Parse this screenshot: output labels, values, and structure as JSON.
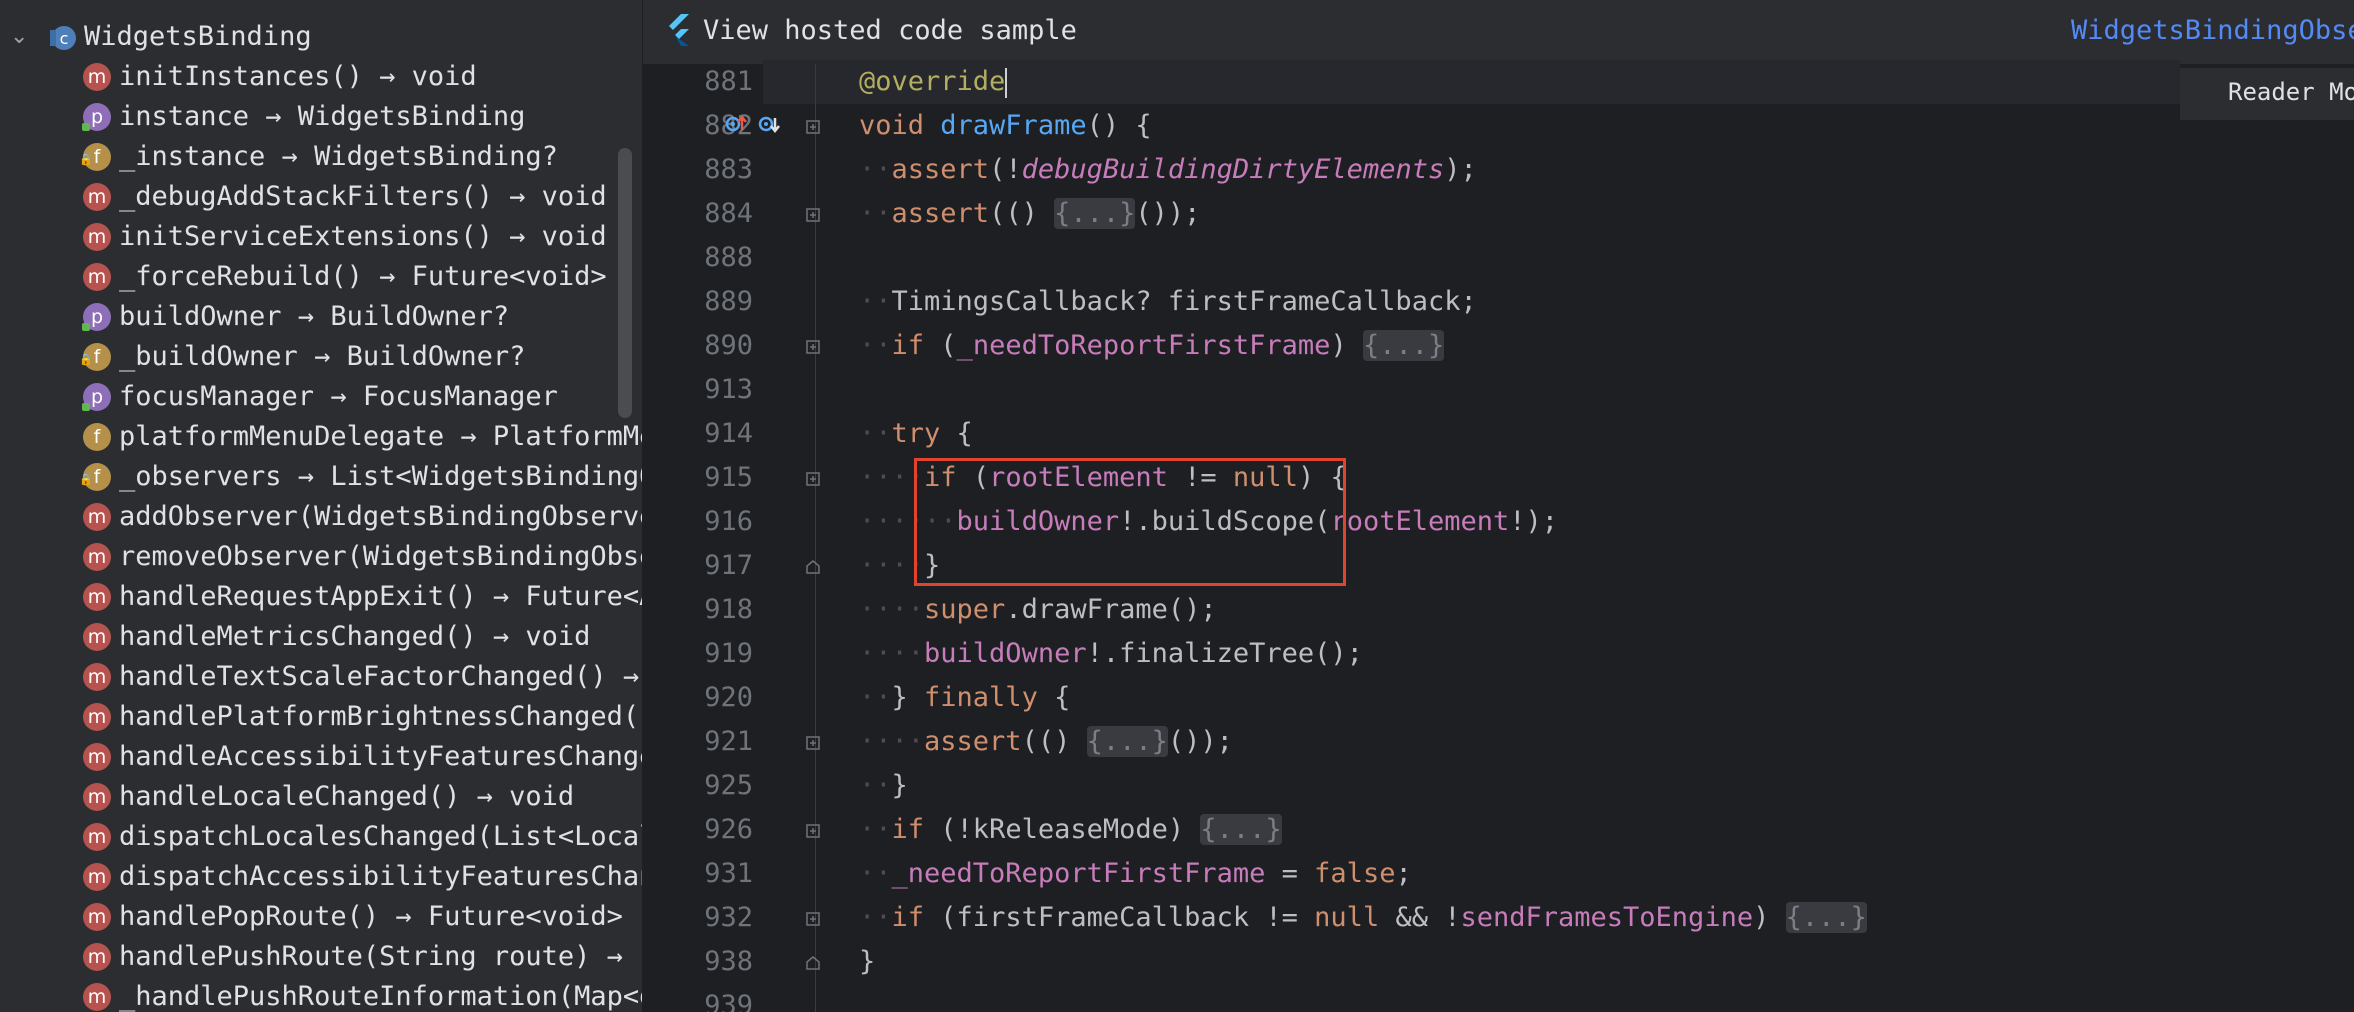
{
  "structure": {
    "root": {
      "label": "WidgetsBinding",
      "badge": "C"
    },
    "items": [
      {
        "badge": "m",
        "label": "initInstances() → void"
      },
      {
        "badge": "p",
        "label": "instance → WidgetsBinding"
      },
      {
        "badge": "f",
        "label": "_instance → WidgetsBinding?"
      },
      {
        "badge": "m",
        "label": "_debugAddStackFilters() → void"
      },
      {
        "badge": "m",
        "label": "initServiceExtensions() → void"
      },
      {
        "badge": "m",
        "label": "_forceRebuild() → Future<void>"
      },
      {
        "badge": "p",
        "label": "buildOwner → BuildOwner?"
      },
      {
        "badge": "f",
        "label": "_buildOwner → BuildOwner?"
      },
      {
        "badge": "p",
        "label": "focusManager → FocusManager"
      },
      {
        "badge": "f",
        "label": "platformMenuDelegate → PlatformMenuDelegate"
      },
      {
        "badge": "f",
        "label": "_observers → List<WidgetsBindingObserver>"
      },
      {
        "badge": "m",
        "label": "addObserver(WidgetsBindingObserver observer)"
      },
      {
        "badge": "m",
        "label": "removeObserver(WidgetsBindingObserver observer)"
      },
      {
        "badge": "m",
        "label": "handleRequestAppExit() → Future<AppExitResponse>"
      },
      {
        "badge": "m",
        "label": "handleMetricsChanged() → void"
      },
      {
        "badge": "m",
        "label": "handleTextScaleFactorChanged() → void"
      },
      {
        "badge": "m",
        "label": "handlePlatformBrightnessChanged() → void"
      },
      {
        "badge": "m",
        "label": "handleAccessibilityFeaturesChanged() → void"
      },
      {
        "badge": "m",
        "label": "handleLocaleChanged() → void"
      },
      {
        "badge": "m",
        "label": "dispatchLocalesChanged(List<Locale>? locales)"
      },
      {
        "badge": "m",
        "label": "dispatchAccessibilityFeaturesChanged() → void"
      },
      {
        "badge": "m",
        "label": "handlePopRoute() → Future<void>"
      },
      {
        "badge": "m",
        "label": "handlePushRoute(String route) → Future<void>"
      },
      {
        "badge": "m",
        "label": "_handlePushRouteInformation(Map<dynamic, dynamic> routeArguments)"
      }
    ]
  },
  "editor": {
    "banner_link": "View hosted code sample",
    "banner_right": "WidgetsBindingObserver",
    "reader_mode": "Reader Mode",
    "lines": [
      {
        "num": "881",
        "ind": 0,
        "tokens": [
          {
            "t": "@override",
            "c": "ann"
          }
        ],
        "cursor": true
      },
      {
        "num": "882",
        "ind": 0,
        "tokens": [
          {
            "t": "void ",
            "c": "kw"
          },
          {
            "t": "drawFrame",
            "c": "fn"
          },
          {
            "t": "() {",
            "c": ""
          }
        ]
      },
      {
        "num": "883",
        "ind": 1,
        "tokens": [
          {
            "t": "assert",
            "c": "kw"
          },
          {
            "t": "(!",
            "c": ""
          },
          {
            "t": "debugBuildingDirtyElements",
            "c": "gf"
          },
          {
            "t": ");",
            "c": ""
          }
        ]
      },
      {
        "num": "884",
        "ind": 1,
        "tokens": [
          {
            "t": "assert",
            "c": "kw"
          },
          {
            "t": "(() ",
            "c": ""
          },
          {
            "t": "{...}",
            "c": "fold"
          },
          {
            "t": "());",
            "c": ""
          }
        ]
      },
      {
        "num": "888",
        "ind": 0,
        "tokens": []
      },
      {
        "num": "889",
        "ind": 1,
        "tokens": [
          {
            "t": "TimingsCallback? firstFrameCallback;",
            "c": ""
          }
        ]
      },
      {
        "num": "890",
        "ind": 1,
        "tokens": [
          {
            "t": "if ",
            "c": "kw"
          },
          {
            "t": "(",
            "c": ""
          },
          {
            "t": "_needToReportFirstFrame",
            "c": "fld"
          },
          {
            "t": ") ",
            "c": ""
          },
          {
            "t": "{...}",
            "c": "fold"
          }
        ]
      },
      {
        "num": "913",
        "ind": 0,
        "tokens": []
      },
      {
        "num": "914",
        "ind": 1,
        "tokens": [
          {
            "t": "try ",
            "c": "kw"
          },
          {
            "t": "{",
            "c": ""
          }
        ]
      },
      {
        "num": "915",
        "ind": 2,
        "tokens": [
          {
            "t": "if ",
            "c": "kw"
          },
          {
            "t": "(",
            "c": ""
          },
          {
            "t": "rootElement",
            "c": "fld"
          },
          {
            "t": " != ",
            "c": ""
          },
          {
            "t": "null",
            "c": "kw"
          },
          {
            "t": ") {",
            "c": ""
          }
        ]
      },
      {
        "num": "916",
        "ind": 3,
        "tokens": [
          {
            "t": "buildOwner",
            "c": "fld"
          },
          {
            "t": "!.buildScope(",
            "c": ""
          },
          {
            "t": "rootElement",
            "c": "fld"
          },
          {
            "t": "!);",
            "c": ""
          }
        ]
      },
      {
        "num": "917",
        "ind": 2,
        "tokens": [
          {
            "t": "}",
            "c": ""
          }
        ]
      },
      {
        "num": "918",
        "ind": 2,
        "tokens": [
          {
            "t": "super",
            "c": "kw"
          },
          {
            "t": ".drawFrame();",
            "c": ""
          }
        ]
      },
      {
        "num": "919",
        "ind": 2,
        "tokens": [
          {
            "t": "buildOwner",
            "c": "fld"
          },
          {
            "t": "!.finalizeTree();",
            "c": ""
          }
        ]
      },
      {
        "num": "920",
        "ind": 1,
        "tokens": [
          {
            "t": "} ",
            "c": ""
          },
          {
            "t": "finally ",
            "c": "kw"
          },
          {
            "t": "{",
            "c": ""
          }
        ]
      },
      {
        "num": "921",
        "ind": 2,
        "tokens": [
          {
            "t": "assert",
            "c": "kw"
          },
          {
            "t": "(() ",
            "c": ""
          },
          {
            "t": "{...}",
            "c": "fold"
          },
          {
            "t": "());",
            "c": ""
          }
        ]
      },
      {
        "num": "925",
        "ind": 1,
        "tokens": [
          {
            "t": "}",
            "c": ""
          }
        ]
      },
      {
        "num": "926",
        "ind": 1,
        "tokens": [
          {
            "t": "if ",
            "c": "kw"
          },
          {
            "t": "(!kReleaseMode) ",
            "c": ""
          },
          {
            "t": "{...}",
            "c": "fold"
          }
        ]
      },
      {
        "num": "931",
        "ind": 1,
        "tokens": [
          {
            "t": "_needToReportFirstFrame",
            "c": "fld"
          },
          {
            "t": " = ",
            "c": ""
          },
          {
            "t": "false",
            "c": "kw"
          },
          {
            "t": ";",
            "c": ""
          }
        ]
      },
      {
        "num": "932",
        "ind": 1,
        "tokens": [
          {
            "t": "if ",
            "c": "kw"
          },
          {
            "t": "(firstFrameCallback != ",
            "c": ""
          },
          {
            "t": "null",
            "c": "kw"
          },
          {
            "t": " && !",
            "c": ""
          },
          {
            "t": "sendFramesToEngine",
            "c": "fld"
          },
          {
            "t": ") ",
            "c": ""
          },
          {
            "t": "{...}",
            "c": "fold"
          }
        ]
      },
      {
        "num": "938",
        "ind": 0,
        "tokens": [
          {
            "t": "}",
            "c": ""
          }
        ]
      },
      {
        "num": "939",
        "ind": 0,
        "tokens": []
      }
    ]
  }
}
